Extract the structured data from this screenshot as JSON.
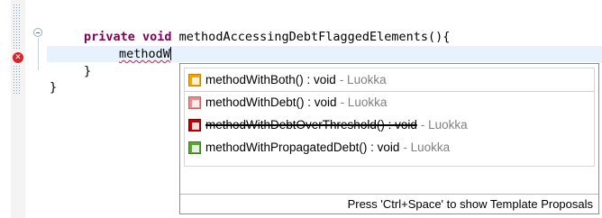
{
  "editor": {
    "line_method": {
      "keywords": "private void",
      "signature": " methodAccessingDebtFlaggedElements(){"
    },
    "line_typing": "methodW",
    "line_close_inner": "}",
    "line_close_outer": "}"
  },
  "autocomplete": {
    "proposals": [
      {
        "name": "methodWithBoth() : void",
        "source": "- Luokka",
        "icon": "method-both-icon",
        "color": "#f5a400",
        "deprecated": false
      },
      {
        "name": "methodWithDebt() : void",
        "source": "- Luokka",
        "icon": "method-debt-icon",
        "color": "#f08a8a",
        "deprecated": false
      },
      {
        "name": "methodWithDebtOverThreshold() : void",
        "source": "- Luokka",
        "icon": "method-debt-threshold-icon",
        "color": "#c00000",
        "deprecated": true
      },
      {
        "name": "methodWithPropagatedDebt() : void",
        "source": "- Luokka",
        "icon": "method-propagated-debt-icon",
        "color": "#5aa532",
        "deprecated": false
      }
    ],
    "footer_hint": "Press 'Ctrl+Space' to show Template Proposals"
  },
  "colors": {
    "keyword": "#7f0055",
    "current_line": "#e8f2fe",
    "error": "#d8222a"
  }
}
